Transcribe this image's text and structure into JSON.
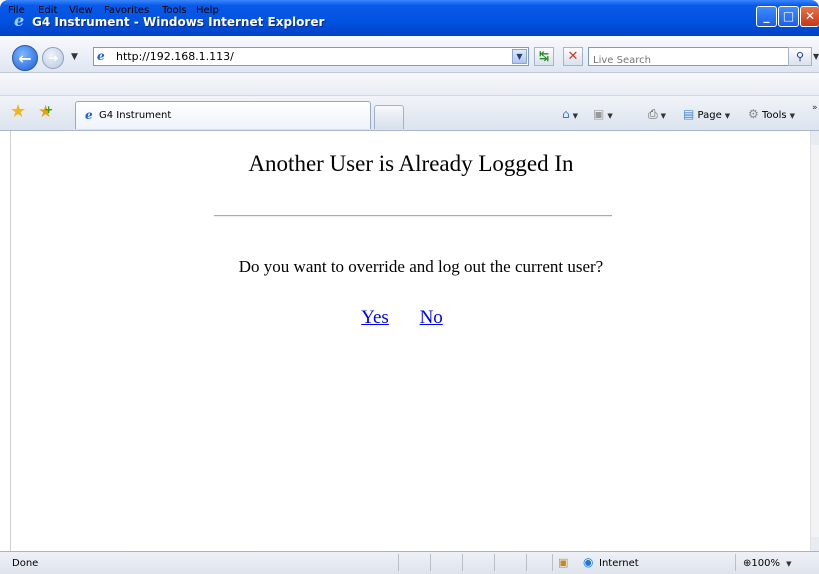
{
  "window": {
    "title": "G4 Instrument - Windows Internet Explorer",
    "min_glyph": "_",
    "max_glyph": "□",
    "close_glyph": "✕"
  },
  "address": {
    "url": "http://192.168.1.113/",
    "search_placeholder": "Live Search"
  },
  "menu": [
    "File",
    "Edit",
    "View",
    "Favorites",
    "Tools",
    "Help"
  ],
  "tab": {
    "label": "G4 Instrument"
  },
  "toolbar": {
    "page_label": "Page",
    "tools_label": "Tools"
  },
  "content": {
    "heading": "Another User is Already Logged In",
    "question": "Do you want to override and log out the current user?",
    "yes_label": "Yes",
    "no_label": "No"
  },
  "status": {
    "text": "Done",
    "zone": "Internet",
    "zoom": "100%"
  },
  "icons": {
    "title": "ie-logo-icon",
    "back": "back-arrow-icon",
    "forward": "forward-arrow-icon",
    "refresh": "refresh-icon",
    "stop": "stop-icon",
    "search": "search-icon",
    "favorites": "star-icon",
    "add_favorite": "add-favorite-icon",
    "home": "home-icon",
    "feeds": "feed-icon",
    "print": "print-icon",
    "page": "page-icon",
    "tools": "gear-icon",
    "security": "lock-icon",
    "zone": "globe-icon",
    "zoom": "zoom-icon"
  },
  "colors": {
    "titlebar": "#0052e0",
    "link": "#0000ee"
  }
}
